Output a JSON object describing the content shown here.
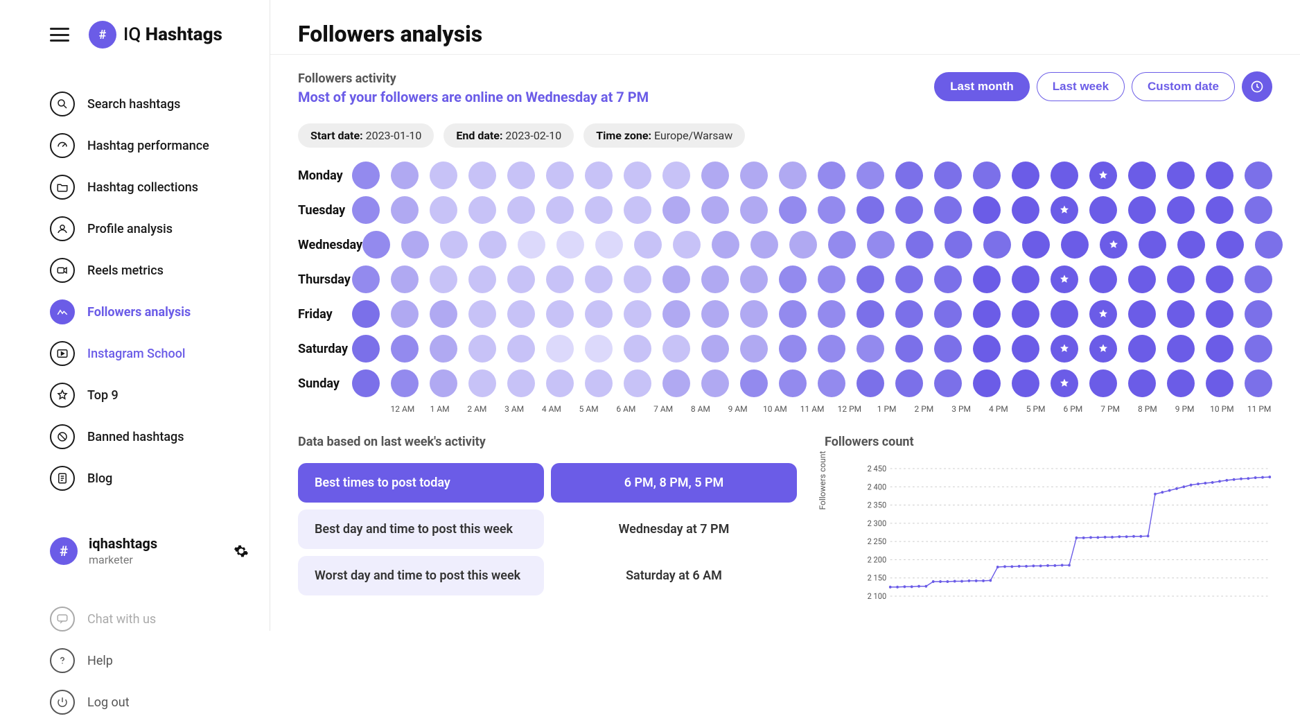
{
  "app": {
    "brand_part1": "IQ",
    "brand_part2": "Hashtags"
  },
  "sidebar": {
    "items": [
      {
        "label": "Search hashtags",
        "icon": "search"
      },
      {
        "label": "Hashtag performance",
        "icon": "gauge"
      },
      {
        "label": "Hashtag collections",
        "icon": "folder"
      },
      {
        "label": "Profile analysis",
        "icon": "profile"
      },
      {
        "label": "Reels metrics",
        "icon": "video"
      },
      {
        "label": "Followers analysis",
        "icon": "activity",
        "active": true
      },
      {
        "label": "Instagram School",
        "icon": "play",
        "school": true
      },
      {
        "label": "Top 9",
        "icon": "star"
      },
      {
        "label": "Banned hashtags",
        "icon": "ban"
      },
      {
        "label": "Blog",
        "icon": "doc"
      }
    ],
    "user": {
      "name": "iqhashtags",
      "role": "marketer",
      "badge": "#"
    },
    "chat_label": "Chat with us",
    "help_label": "Help",
    "logout_label": "Log out"
  },
  "page": {
    "title": "Followers analysis",
    "activity_label": "Followers activity",
    "highlight": "Most of your followers are online on Wednesday at 7 PM",
    "range": {
      "last_month": "Last month",
      "last_week": "Last week",
      "custom": "Custom date",
      "active": "last_month"
    },
    "start_date_label": "Start date:",
    "start_date": "2023-01-10",
    "end_date_label": "End date:",
    "end_date": "2023-02-10",
    "tz_label": "Time zone:",
    "tz": "Europe/Warsaw"
  },
  "chart_data": {
    "heatmap": {
      "type": "heatmap",
      "days": [
        "Monday",
        "Tuesday",
        "Wednesday",
        "Thursday",
        "Friday",
        "Saturday",
        "Sunday"
      ],
      "hours": [
        "12 AM",
        "1 AM",
        "2 AM",
        "3 AM",
        "4 AM",
        "5 AM",
        "6 AM",
        "7 AM",
        "8 AM",
        "9 AM",
        "10 AM",
        "11 AM",
        "12 PM",
        "1 PM",
        "2 PM",
        "3 PM",
        "4 PM",
        "5 PM",
        "6 PM",
        "7 PM",
        "8 PM",
        "9 PM",
        "10 PM",
        "11 PM"
      ],
      "values": [
        [
          4,
          3,
          2,
          2,
          2,
          2,
          2,
          2,
          2,
          3,
          3,
          3,
          4,
          4,
          5,
          5,
          5,
          6,
          6,
          6,
          6,
          6,
          6,
          5
        ],
        [
          4,
          3,
          2,
          2,
          2,
          2,
          2,
          2,
          3,
          3,
          3,
          4,
          4,
          5,
          5,
          5,
          6,
          6,
          6,
          6,
          6,
          6,
          6,
          5
        ],
        [
          4,
          3,
          2,
          2,
          1,
          1,
          1,
          2,
          2,
          3,
          3,
          3,
          4,
          4,
          5,
          5,
          5,
          6,
          6,
          6,
          6,
          6,
          6,
          5
        ],
        [
          4,
          3,
          2,
          2,
          2,
          2,
          2,
          2,
          3,
          3,
          3,
          4,
          4,
          5,
          5,
          5,
          6,
          6,
          6,
          6,
          6,
          6,
          6,
          5
        ],
        [
          5,
          3,
          3,
          2,
          2,
          2,
          2,
          2,
          3,
          3,
          3,
          4,
          4,
          5,
          5,
          5,
          6,
          6,
          6,
          6,
          6,
          6,
          6,
          5
        ],
        [
          5,
          4,
          3,
          2,
          2,
          1,
          1,
          2,
          2,
          3,
          3,
          4,
          4,
          4,
          5,
          5,
          6,
          6,
          6,
          6,
          6,
          6,
          6,
          5
        ],
        [
          5,
          4,
          3,
          2,
          2,
          2,
          2,
          2,
          3,
          3,
          4,
          4,
          4,
          5,
          5,
          5,
          6,
          6,
          6,
          6,
          6,
          6,
          6,
          5
        ]
      ],
      "starred": {
        "Monday": [
          19
        ],
        "Tuesday": [
          18
        ],
        "Wednesday": [
          19
        ],
        "Thursday": [
          18
        ],
        "Friday": [
          19
        ],
        "Saturday": [
          18,
          19
        ],
        "Sunday": [
          18
        ]
      }
    },
    "followers_count": {
      "type": "line",
      "title": "Followers count",
      "ylabel": "Followers count",
      "ylim": [
        2100,
        2450
      ],
      "yticks": [
        2100,
        2150,
        2200,
        2250,
        2300,
        2350,
        2400,
        2450
      ],
      "values": [
        2125,
        2125,
        2126,
        2126,
        2127,
        2127,
        2140,
        2140,
        2140,
        2141,
        2141,
        2142,
        2142,
        2142,
        2143,
        2180,
        2181,
        2181,
        2182,
        2182,
        2183,
        2183,
        2184,
        2184,
        2185,
        2185,
        2260,
        2260,
        2261,
        2261,
        2262,
        2262,
        2263,
        2263,
        2264,
        2264,
        2265,
        2380,
        2385,
        2390,
        2395,
        2400,
        2405,
        2408,
        2410,
        2412,
        2415,
        2418,
        2420,
        2422,
        2423,
        2425,
        2426,
        2427
      ]
    }
  },
  "stats": {
    "section_title": "Data based on last week's activity",
    "rows": [
      {
        "label": "Best times to post today",
        "value": "6 PM, 8 PM, 5 PM",
        "primary": true
      },
      {
        "label": "Best day and time to post this week",
        "value": "Wednesday at 7 PM"
      },
      {
        "label": "Worst day and time to post this week",
        "value": "Saturday at 6 AM"
      }
    ],
    "followers_title": "Followers count"
  }
}
